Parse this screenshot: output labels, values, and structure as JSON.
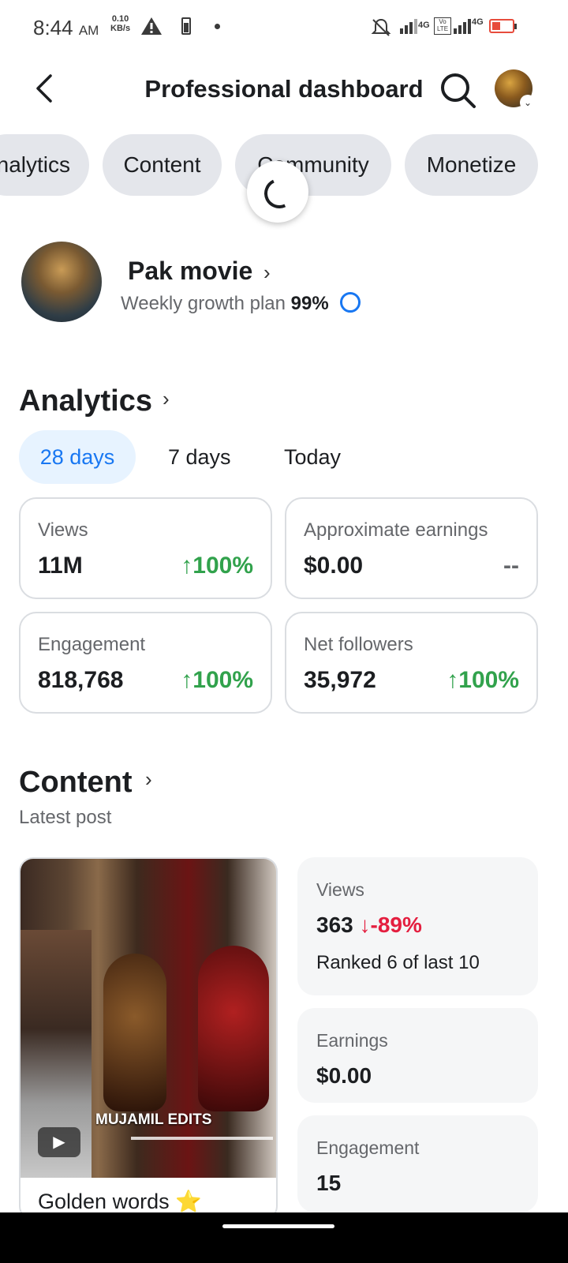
{
  "status": {
    "time": "8:44",
    "ampm": "AM",
    "net_speed": "0.10",
    "net_unit": "KB/s",
    "net1": "4G",
    "net2": "4G",
    "volte": "Vo LTE"
  },
  "header": {
    "title": "Professional dashboard"
  },
  "tabs": [
    {
      "label": "Analytics"
    },
    {
      "label": "Content"
    },
    {
      "label": "Community"
    },
    {
      "label": "Monetize"
    }
  ],
  "profile": {
    "name": "Pak movie",
    "plan_label": "Weekly growth plan",
    "plan_value": "99%"
  },
  "analytics": {
    "title": "Analytics",
    "ranges": [
      {
        "label": "28 days",
        "active": true
      },
      {
        "label": "7 days"
      },
      {
        "label": "Today"
      }
    ],
    "cards": [
      {
        "label": "Views",
        "value": "11M",
        "change": "100%"
      },
      {
        "label": "Approximate earnings",
        "value": "$0.00",
        "change": "--"
      },
      {
        "label": "Engagement",
        "value": "818,768",
        "change": "100%"
      },
      {
        "label": "Net followers",
        "value": "35,972",
        "change": "100%"
      }
    ]
  },
  "content": {
    "title": "Content",
    "latest_label": "Latest post",
    "post": {
      "caption": "Golden words ⭐",
      "watermark": "MUJAMIL EDITS"
    },
    "stats": {
      "views_label": "Views",
      "views_value": "363",
      "views_change": "-89%",
      "views_rank": "Ranked 6 of last 10",
      "earnings_label": "Earnings",
      "earnings_value": "$0.00",
      "engagement_label": "Engagement",
      "engagement_value": "15"
    }
  },
  "colors": {
    "accent": "#1877f2",
    "positive": "#31a24c",
    "negative": "#e41e3f",
    "pill_bg": "#e4e6eb"
  }
}
